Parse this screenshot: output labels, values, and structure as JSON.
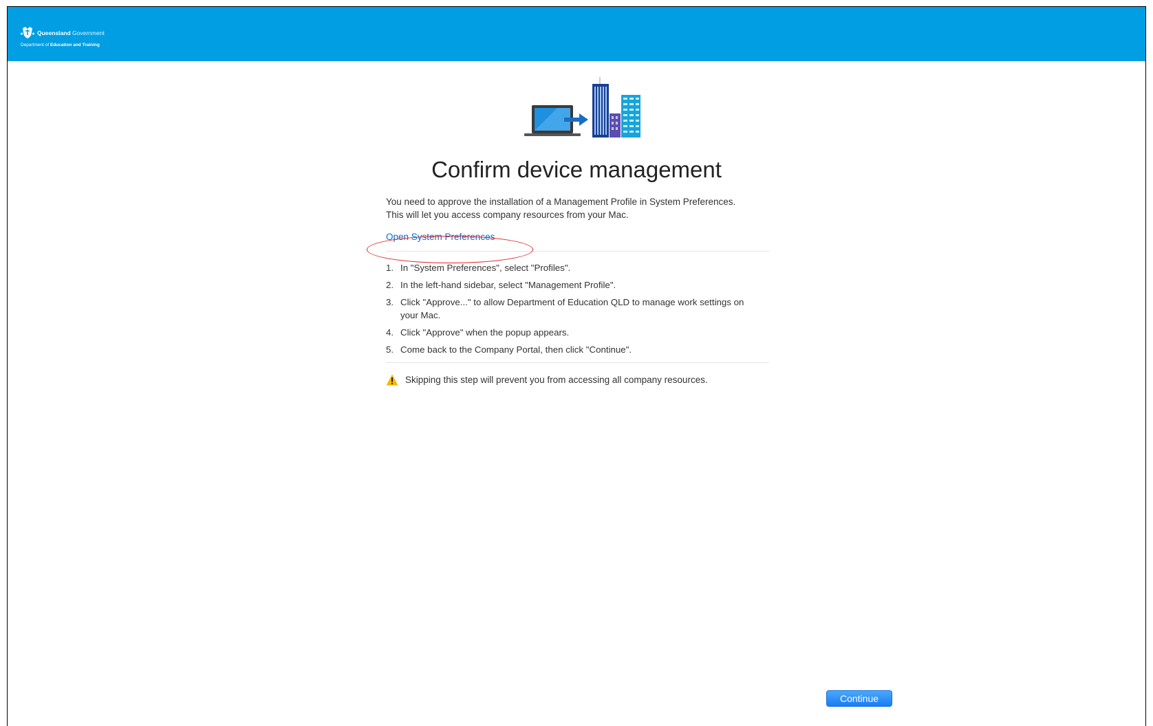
{
  "header": {
    "brand_strong": "Queensland",
    "brand_light": " Government",
    "dept_prefix": "Department of ",
    "dept_strong": "Education and Training"
  },
  "main": {
    "title": "Confirm device management",
    "intro_line1": "You need to approve the installation of a Management Profile in System Preferences.",
    "intro_line2": "This will let you access company resources from your Mac.",
    "link_label": "Open System Preferences",
    "steps": [
      {
        "num": "1.",
        "text": "In \"System Preferences\", select \"Profiles\"."
      },
      {
        "num": "2.",
        "text": "In the left-hand sidebar, select \"Management Profile\"."
      },
      {
        "num": "3.",
        "text": "Click \"Approve...\" to allow Department of Education QLD to manage work settings on your Mac."
      },
      {
        "num": "4.",
        "text": "Click \"Approve\" when the popup appears."
      },
      {
        "num": "5.",
        "text": "Come back to the Company Portal, then click \"Continue\"."
      }
    ],
    "warning": "Skipping this step will prevent you from accessing all company resources."
  },
  "footer": {
    "continue_label": "Continue"
  },
  "colors": {
    "header_bg": "#019ee3",
    "link": "#0b6ad2",
    "button": "#1a7cf4",
    "annotation": "#e02020",
    "warning_icon": "#f5b800"
  },
  "icons": {
    "hero": "laptop-to-building-illustration",
    "crest": "qld-crest-icon",
    "warning": "warning-triangle-icon"
  }
}
